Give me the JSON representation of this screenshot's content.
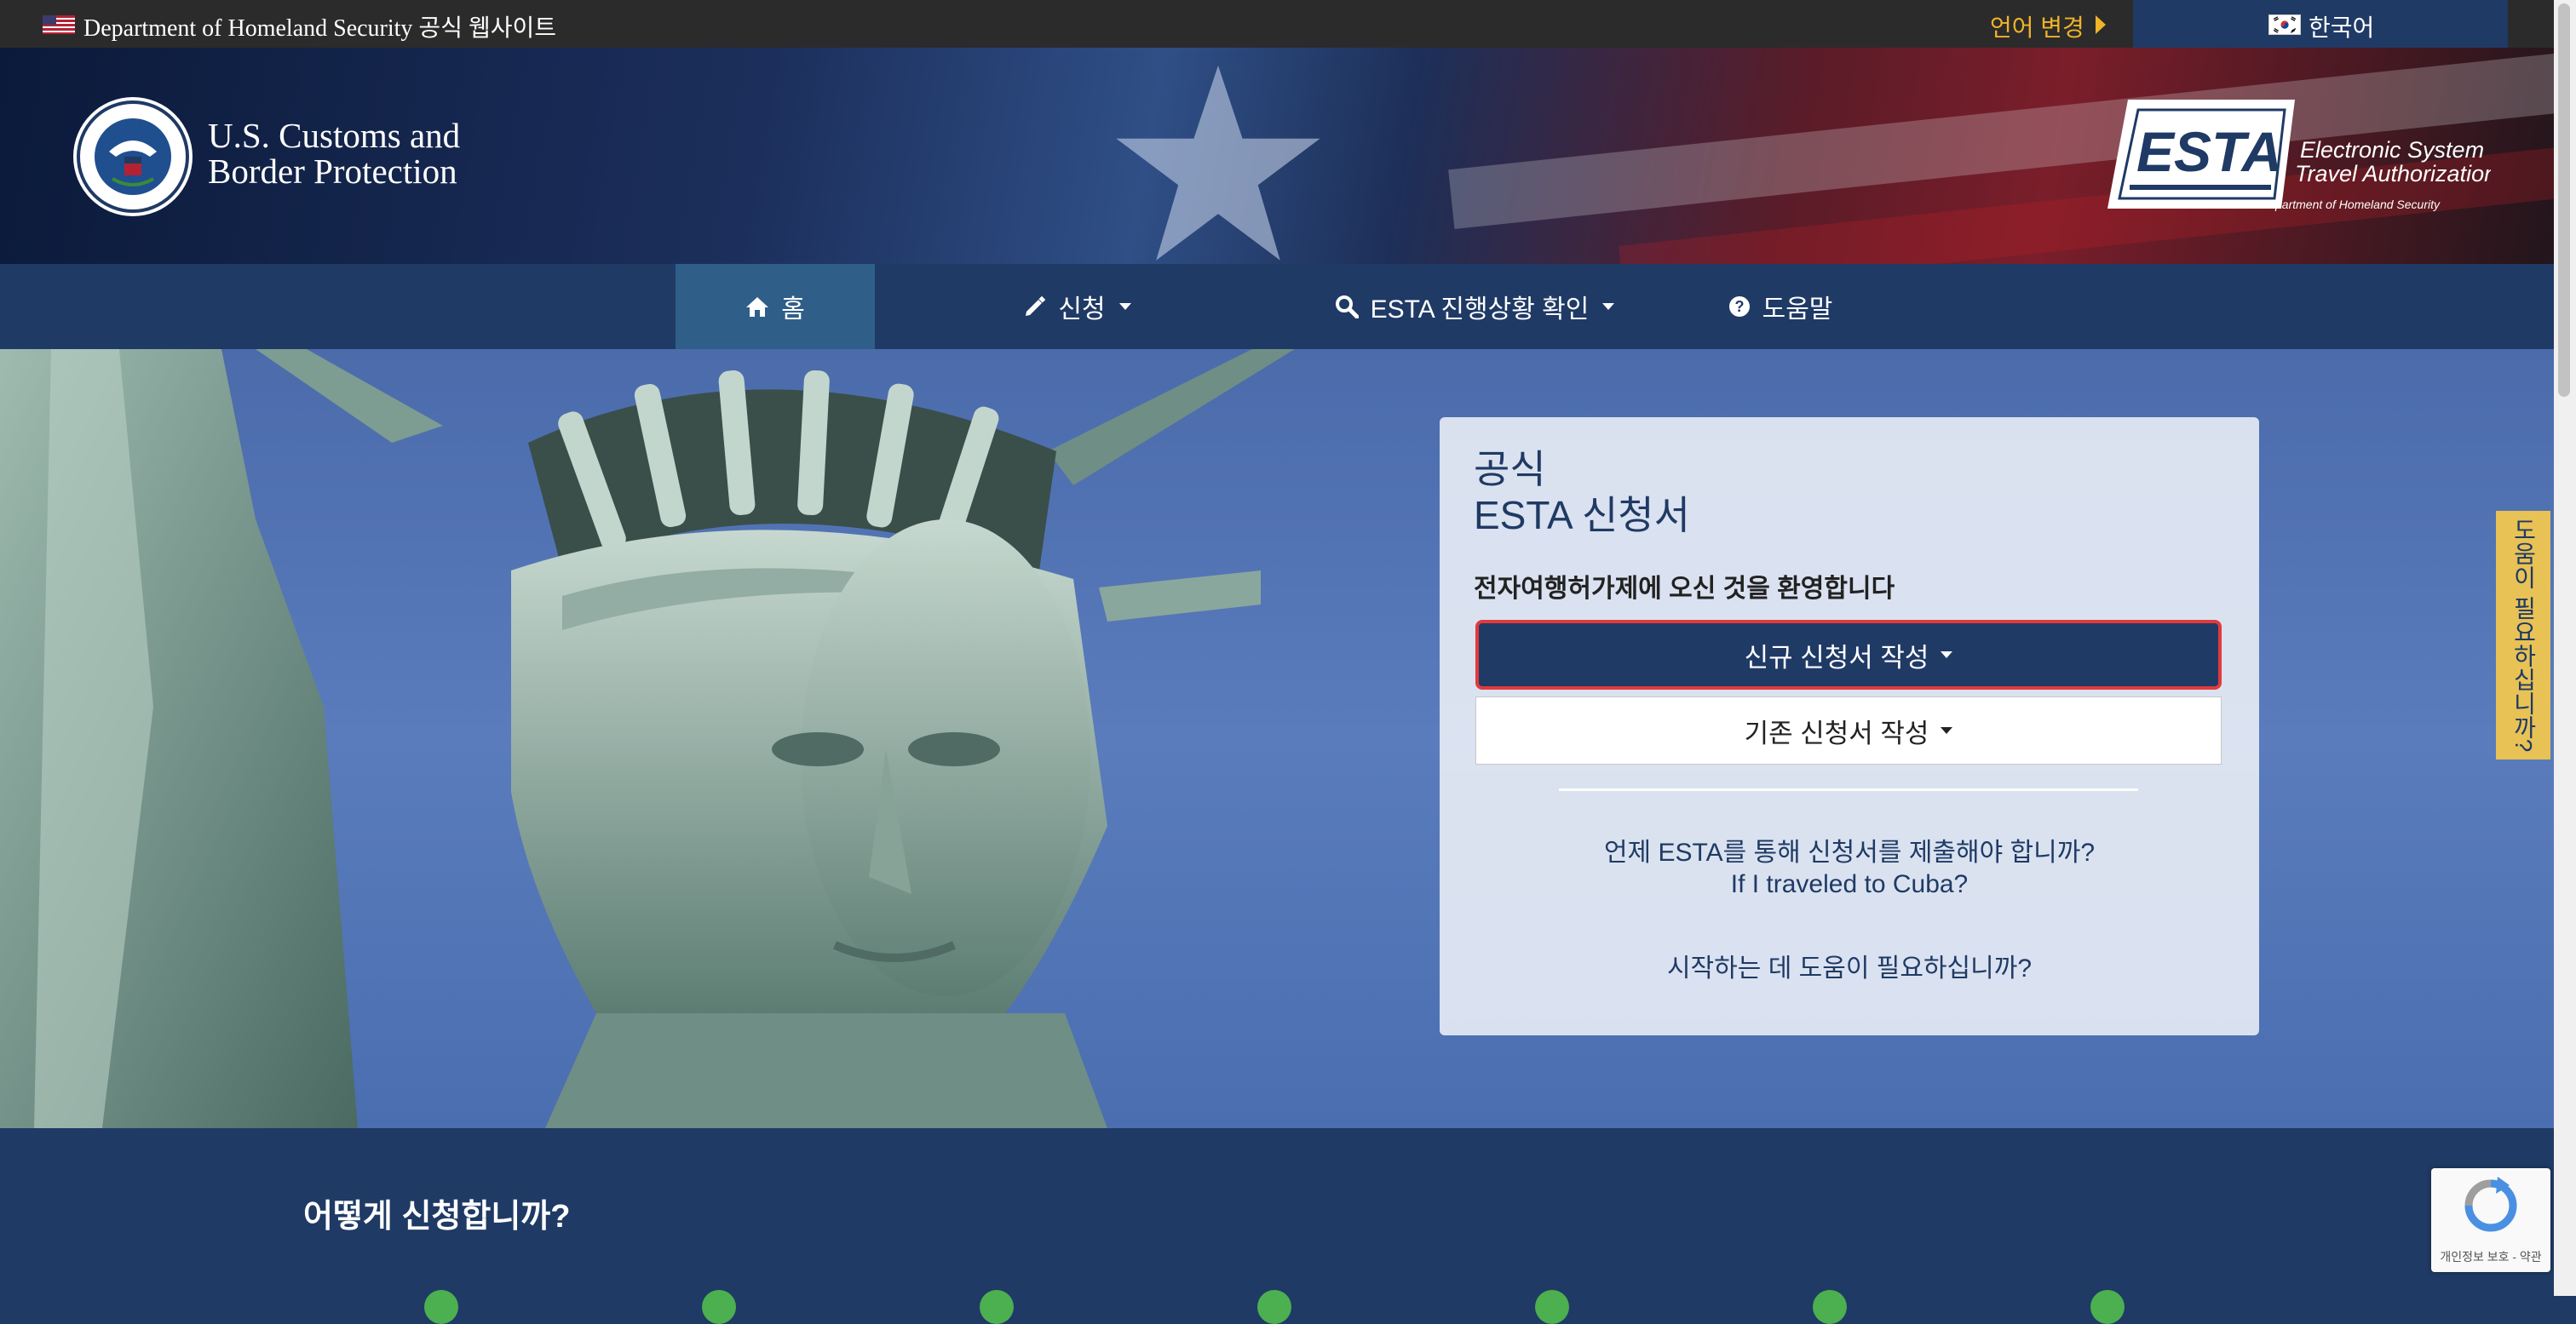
{
  "topbar": {
    "site_label": "Department of Homeland Security 공식 웹사이트",
    "language_change": "언어 변경",
    "current_language": "한국어"
  },
  "header": {
    "agency_name_line1": "U.S. Customs and",
    "agency_name_line2": "Border Protection",
    "esta_logo_text": "ESTA",
    "esta_tagline_line1": "Electronic System for",
    "esta_tagline_line2": "Travel Authorization",
    "esta_dept": "U.S. Department of Homeland Security"
  },
  "nav": {
    "items": [
      {
        "label": "홈",
        "icon": "home-icon",
        "active": true
      },
      {
        "label": "신청",
        "icon": "pencil-icon",
        "dropdown": true
      },
      {
        "label": "ESTA 진행상황 확인",
        "icon": "search-icon",
        "dropdown": true
      },
      {
        "label": "도움말",
        "icon": "question-circle-icon"
      }
    ]
  },
  "card": {
    "title_line1": "공식",
    "title_line2": "ESTA 신청서",
    "welcome": "전자여행허가제에 오신 것을 환영합니다",
    "new_application": "신규 신청서 작성",
    "existing_application": "기존 신청서 작성",
    "link_when_esta": "언제 ESTA를 통해 신청서를 제출해야 합니까?",
    "link_cuba": "If I traveled to Cuba?",
    "link_get_started": "시작하는 데 도움이 필요하십니까?"
  },
  "help_tab": {
    "label": "도움이 필요하십니까?"
  },
  "bottom": {
    "title": "어떻게 신청합니까?"
  },
  "recaptcha": {
    "label": "개인정보 보호 - 약관"
  },
  "colors": {
    "navy": "#203a66",
    "active_nav": "#2f5f88",
    "accent_gold": "#f0b429",
    "help_tab": "#e8c255",
    "focus_red": "#e03b3b"
  }
}
